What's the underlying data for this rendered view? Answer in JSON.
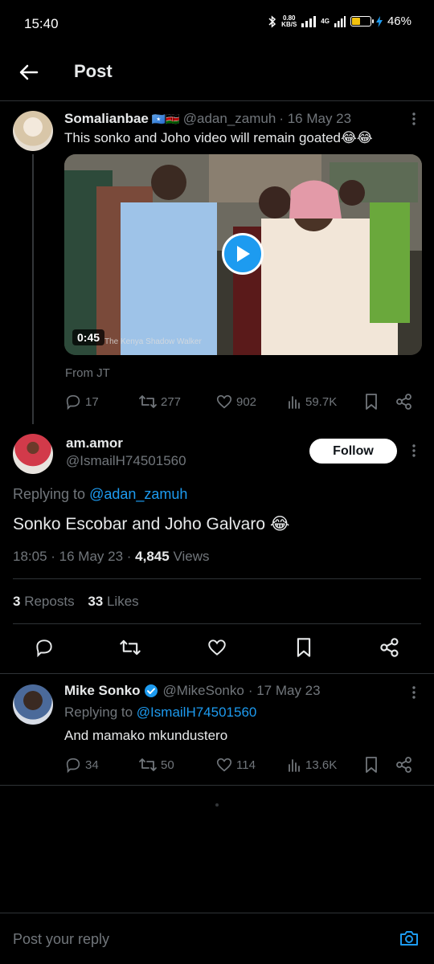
{
  "status_bar": {
    "time": "15:40",
    "net_speed_top": "0.80",
    "net_speed_bottom": "KB/S",
    "network": "4G",
    "battery_percent": "46%",
    "battery_level": 0.46,
    "battery_color": "#f4c20d"
  },
  "header": {
    "title": "Post",
    "back_icon": "arrow-left-icon"
  },
  "tweet1": {
    "display_name": "Somalianbae",
    "flags": "🇸🇴🇰🇪",
    "handle": "@adan_zamuh",
    "date": "· 16 May 23",
    "text": "This sonko and Joho video  will remain goated😂😂",
    "video_duration": "0:45",
    "video_watermark": "The Kenya Shadow Walker",
    "source": "From JT",
    "replies": "17",
    "reposts": "277",
    "likes": "902",
    "views": "59.7K"
  },
  "main_post": {
    "display_name": "am.amor",
    "handle": "@IsmailH74501560",
    "follow_label": "Follow",
    "replying_prefix": "Replying to",
    "replying_to": "@adan_zamuh",
    "text": "Sonko Escobar and Joho Galvaro 😂",
    "time_date": "18:05 · 16 May 23 ·",
    "views_count": "4,845",
    "views_label": "Views",
    "reposts_count": "3",
    "reposts_label": "Reposts",
    "likes_count": "33",
    "likes_label": "Likes"
  },
  "tweet3": {
    "display_name": "Mike Sonko",
    "verified_icon": "verified-badge-icon",
    "handle": "@MikeSonko",
    "date": "· 17 May 23",
    "replying_prefix": "Replying to",
    "replying_to": "@IsmailH74501560",
    "text": "And mamako mkundustero",
    "replies": "34",
    "reposts": "50",
    "likes": "114",
    "views": "13.6K"
  },
  "reply_bar": {
    "placeholder": "Post your reply",
    "camera_icon": "camera-icon"
  },
  "colors": {
    "accent": "#1d9bf0",
    "background": "#000000",
    "muted": "#71767b",
    "divider": "#2f3336"
  }
}
